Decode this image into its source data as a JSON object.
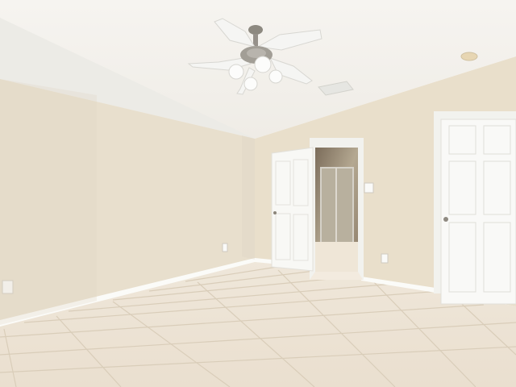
{
  "scene": {
    "colors": {
      "ceiling": "#f4f2ee",
      "ceiling_slope": "#ecebe7",
      "left_wall": "#e9dfcd",
      "back_wall": "#e8decb",
      "right_wall": "#e6dbc6",
      "floor": "#ece3d4",
      "tile_grout": "#d8cbb6",
      "baseboard": "#fbfbf8",
      "door": "#f7f7f4",
      "door_trim": "#f1f1ed",
      "bathroom": "#9d8f7d",
      "fan_metal": "#8d8980",
      "fan_blade": "#f3f3f1"
    },
    "icons": [
      "ceiling-fan-icon",
      "light-bulb-icon",
      "air-vent-icon",
      "smoke-detector-icon",
      "door-icon",
      "outlet-icon",
      "light-switch-icon",
      "shower-icon"
    ]
  }
}
